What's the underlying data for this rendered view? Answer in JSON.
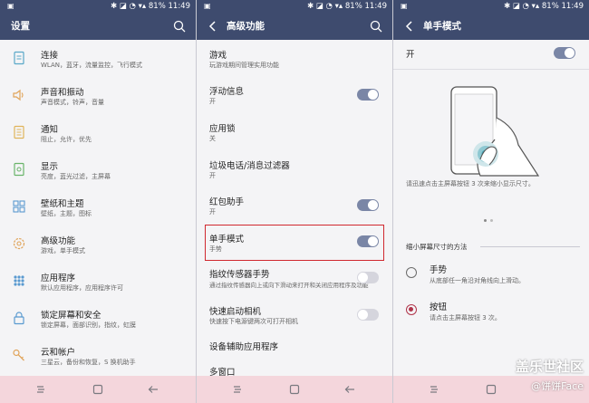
{
  "status_bar": {
    "battery": "81%",
    "time": "11:49"
  },
  "panel1": {
    "title": "设置",
    "items": [
      {
        "title": "连接",
        "subtitle": "WLAN，蓝牙，流量监控，飞行模式",
        "icon": "connections-icon"
      },
      {
        "title": "声音和振动",
        "subtitle": "声音模式，铃声，音量",
        "icon": "sound-icon"
      },
      {
        "title": "通知",
        "subtitle": "阻止，允许，优先",
        "icon": "notifications-icon"
      },
      {
        "title": "显示",
        "subtitle": "亮度，蓝光过滤，主屏幕",
        "icon": "display-icon"
      },
      {
        "title": "壁纸和主题",
        "subtitle": "壁纸，主题，图标",
        "icon": "wallpaper-icon"
      },
      {
        "title": "高级功能",
        "subtitle": "游戏，单手模式",
        "icon": "advanced-gear-icon"
      },
      {
        "title": "应用程序",
        "subtitle": "默认应用程序，应用程序许可",
        "icon": "apps-icon"
      },
      {
        "title": "锁定屏幕和安全",
        "subtitle": "锁定屏幕，面部识别，指纹，虹膜",
        "icon": "lock-icon"
      },
      {
        "title": "云和帐户",
        "subtitle": "三星云，备份和恢复，S 换机助手",
        "icon": "key-icon"
      }
    ]
  },
  "panel2": {
    "title": "高级功能",
    "items": [
      {
        "title": "游戏",
        "subtitle": "玩游戏期间管理实用功能",
        "toggle": null
      },
      {
        "title": "浮动信息",
        "subtitle": "开",
        "toggle": "on"
      },
      {
        "title": "应用锁",
        "subtitle": "关",
        "toggle": null
      },
      {
        "title": "垃圾电话/消息过滤器",
        "subtitle": "开",
        "toggle": null
      },
      {
        "title": "红包助手",
        "subtitle": "开",
        "toggle": "on"
      },
      {
        "title": "单手模式",
        "subtitle": "手势",
        "toggle": "on"
      },
      {
        "title": "指纹传感器手势",
        "subtitle": "通过指纹传感器向上或向下滑动来打开和关闭应用程序及功能",
        "toggle": "off"
      },
      {
        "title": "快速启动相机",
        "subtitle": "快速按下电源键两次可打开相机",
        "toggle": "off"
      },
      {
        "title": "设备辅助应用程序",
        "subtitle": "",
        "toggle": null
      },
      {
        "title": "多窗口",
        "subtitle": "",
        "toggle": null
      }
    ]
  },
  "panel3": {
    "title": "单手模式",
    "switch_label": "开",
    "instruction": "请迅速点击主屏幕按钮 3 次来缩小显示尺寸。",
    "section_header": "缩小屏幕尺寸的方法",
    "options": [
      {
        "title": "手势",
        "subtitle": "从底部任一角沿对角线向上滑动。",
        "selected": false
      },
      {
        "title": "按钮",
        "subtitle": "请点击主屏幕按钮 3 次。",
        "selected": true
      }
    ]
  },
  "watermark": {
    "line1": "盖乐世社区",
    "line2": "@饼饼Face"
  },
  "colors": {
    "header": "#3e4b6e",
    "accent": "#b0344a",
    "highlight": "#d0282f",
    "navbar": "#f4d6dc"
  }
}
